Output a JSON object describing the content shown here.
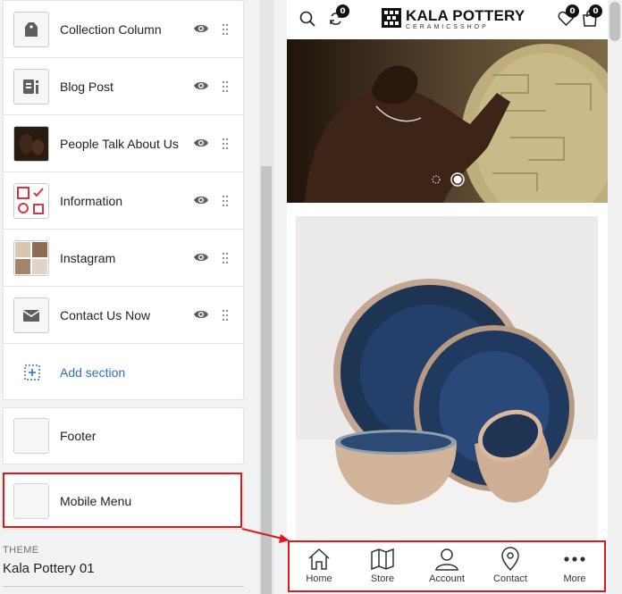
{
  "sections": [
    {
      "label": "Collection Column",
      "icon": "tag-icon"
    },
    {
      "label": "Blog Post",
      "icon": "blog-post-icon"
    },
    {
      "label": "People Talk About Us",
      "icon": "people-talk-thumbnail"
    },
    {
      "label": "Information",
      "icon": "information-thumbnail"
    },
    {
      "label": "Instagram",
      "icon": "instagram-thumbnail"
    },
    {
      "label": "Contact Us Now",
      "icon": "envelope-icon"
    }
  ],
  "add_section_label": "Add section",
  "footer_label": "Footer",
  "mobile_menu_label": "Mobile Menu",
  "theme": {
    "caption": "THEME",
    "name": "Kala Pottery 01"
  },
  "preview": {
    "logo_title": "KALA POTTERY",
    "logo_subtitle": "CERAMICSSHOP",
    "compare_count": "0",
    "wishlist_count": "0",
    "cart_count": "0",
    "slide_dots": 2,
    "active_slide": 2
  },
  "mobile_nav": [
    {
      "label": "Home",
      "icon": "home-icon"
    },
    {
      "label": "Store",
      "icon": "map-icon"
    },
    {
      "label": "Account",
      "icon": "account-icon"
    },
    {
      "label": "Contact",
      "icon": "location-pin-icon"
    },
    {
      "label": "More",
      "icon": "more-dots-icon"
    }
  ],
  "colors": {
    "highlight": "#e4161b",
    "link": "#2c6ecb"
  }
}
